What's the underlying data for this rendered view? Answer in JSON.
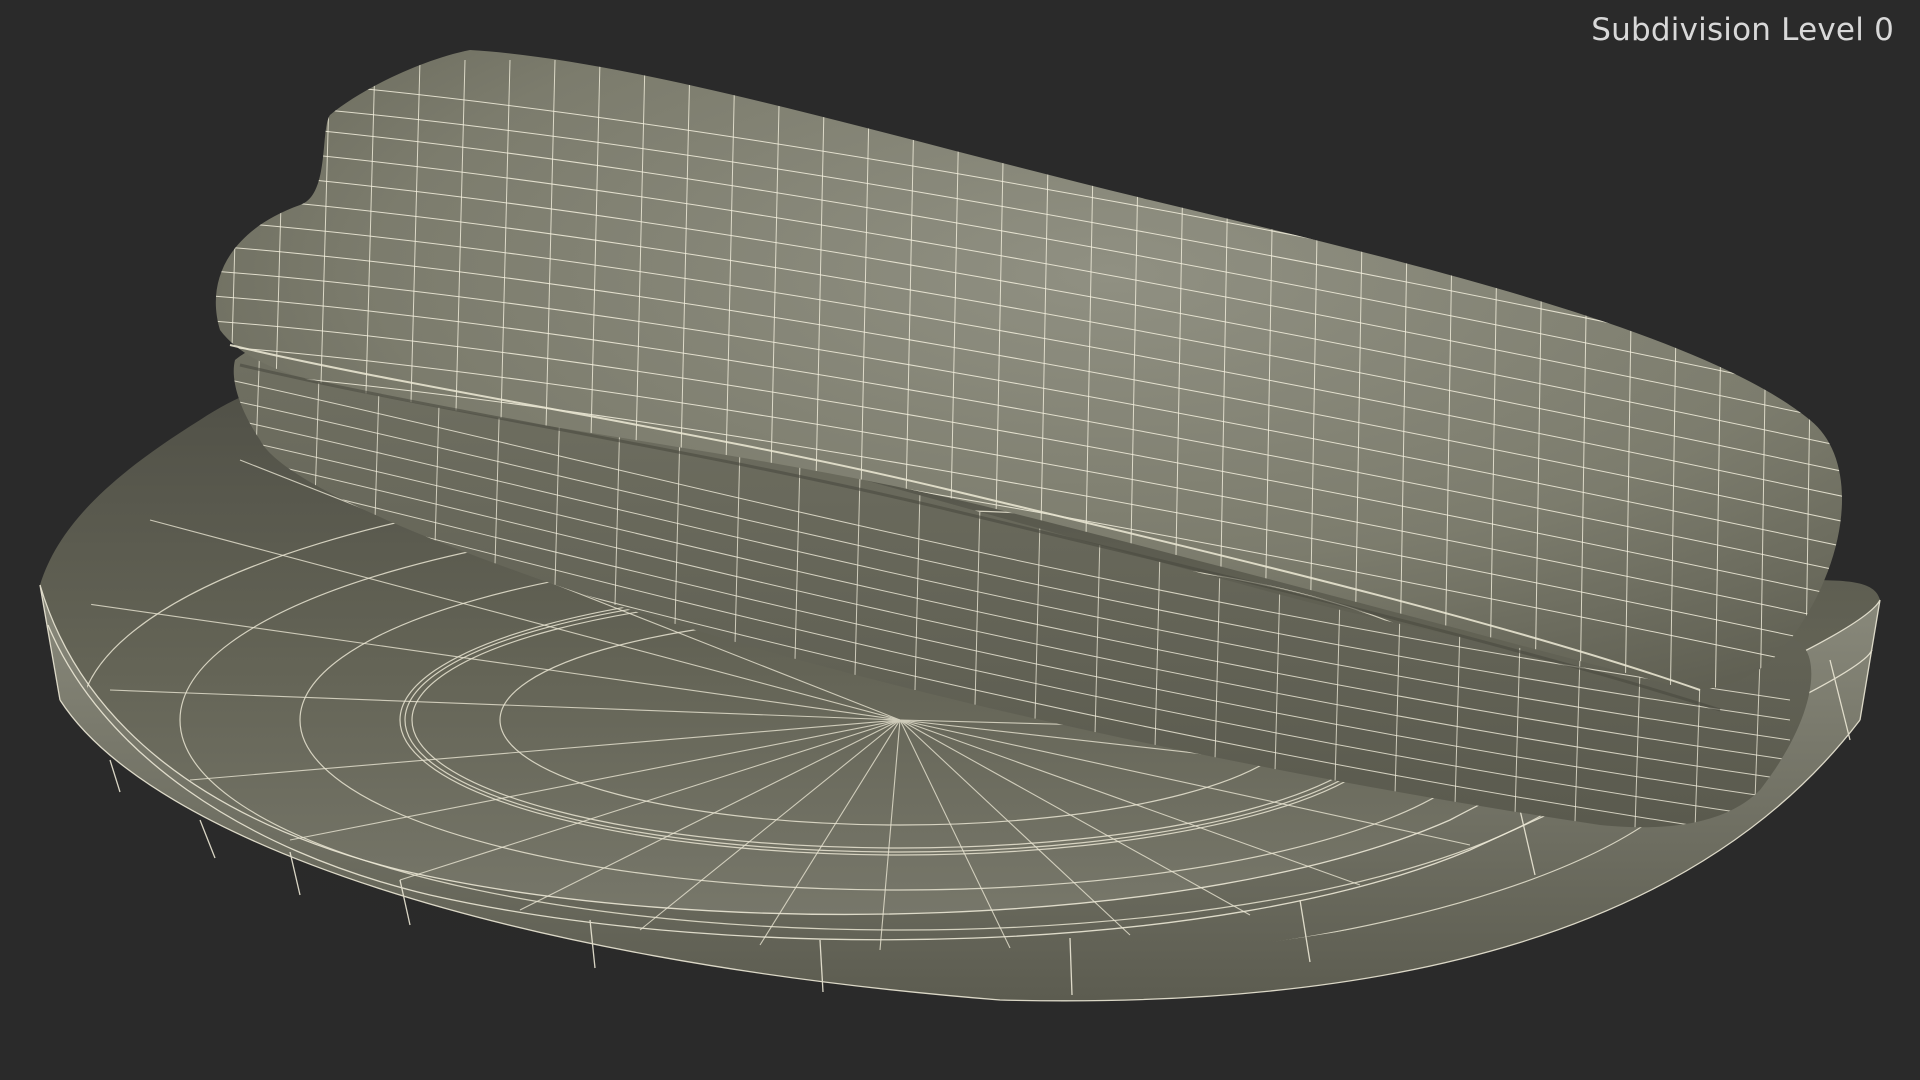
{
  "viewport": {
    "background_color": "#2a2a2a",
    "label": "Subdivision Level 0",
    "label_color": "#d8d8d8"
  },
  "scene": {
    "object": "plate-with-hotdog-wireframe",
    "mesh_fill_color": "#777766",
    "wire_color": "#f2eedc"
  }
}
